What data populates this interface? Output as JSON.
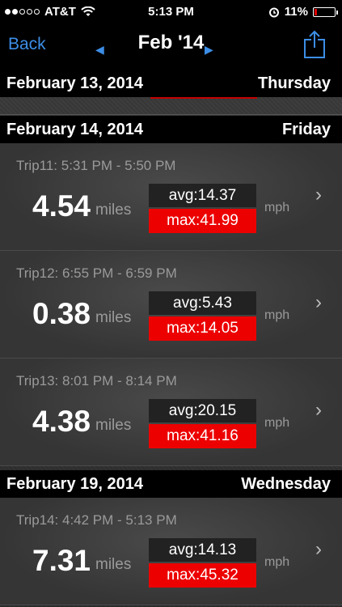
{
  "status_bar": {
    "carrier": "AT&T",
    "time": "5:13 PM",
    "battery": "11%",
    "battery_level": 0.11
  },
  "nav": {
    "back_label": "Back",
    "title": "Feb '14"
  },
  "days": [
    {
      "date": "February 13, 2014",
      "weekday": "Thursday"
    },
    {
      "date": "February 14, 2014",
      "weekday": "Friday"
    },
    {
      "date": "February 19, 2014",
      "weekday": "Wednesday"
    }
  ],
  "trips": [
    {
      "time": "Trip11: 5:31 PM - 5:50 PM",
      "miles": "4.54",
      "unit": "miles",
      "avg": "avg:14.37",
      "max": "max:41.99",
      "speed_unit": "mph"
    },
    {
      "time": "Trip12: 6:55 PM - 6:59 PM",
      "miles": "0.38",
      "unit": "miles",
      "avg": "avg:5.43",
      "max": "max:14.05",
      "speed_unit": "mph"
    },
    {
      "time": "Trip13: 8:01 PM - 8:14 PM",
      "miles": "4.38",
      "unit": "miles",
      "avg": "avg:20.15",
      "max": "max:41.16",
      "speed_unit": "mph"
    },
    {
      "time": "Trip14: 4:42 PM - 5:13 PM",
      "miles": "7.31",
      "unit": "miles",
      "avg": "avg:14.13",
      "max": "max:45.32",
      "speed_unit": "mph"
    }
  ],
  "colors": {
    "accent": "#3c8ee6",
    "max_red": "#ec0000",
    "avg_bg": "#222222"
  }
}
